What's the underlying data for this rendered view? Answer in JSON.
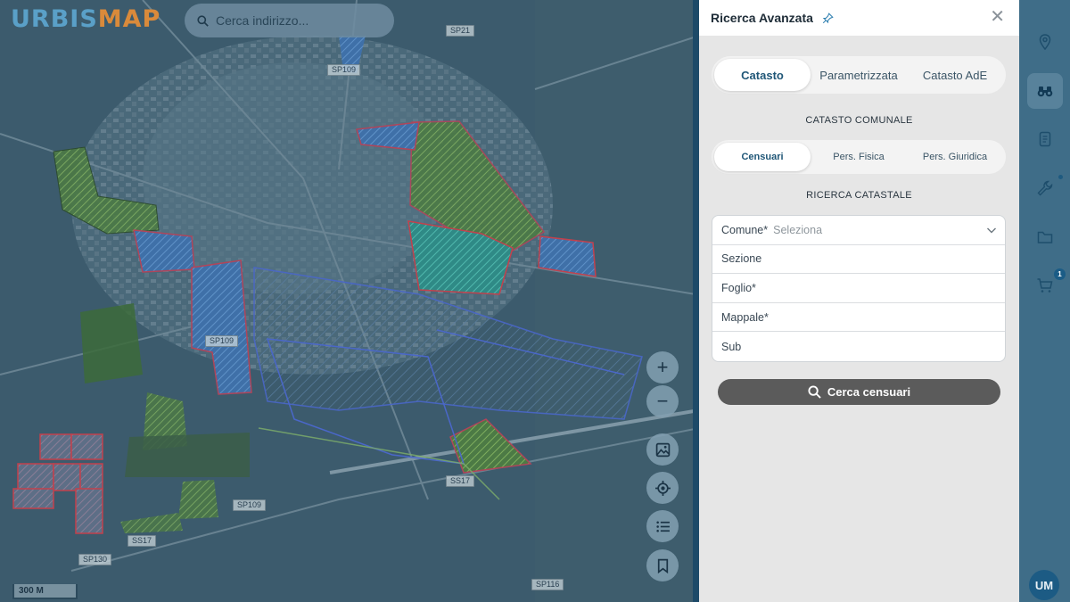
{
  "app": {
    "logo_part1": "URBIS",
    "logo_part2": "MAP"
  },
  "map": {
    "search_placeholder": "Cerca indirizzo...",
    "road_labels": [
      "SP21",
      "SP109",
      "SP109",
      "SP109",
      "SS17",
      "SS17",
      "SP130",
      "SP116"
    ],
    "scale_label": "300 M",
    "controls": {
      "zoom_in": "+",
      "zoom_out": "−",
      "layers_icon": "image-icon",
      "locate_icon": "target-icon",
      "legend_icon": "list-icon",
      "bookmark_icon": "bookmark-icon"
    }
  },
  "panel": {
    "title": "Ricerca Avanzata",
    "pin_icon": "pin-icon",
    "close_icon": "close-icon",
    "tabs": [
      {
        "label": "Catasto",
        "active": true
      },
      {
        "label": "Parametrizzata",
        "active": false
      },
      {
        "label": "Catasto AdE",
        "active": false
      }
    ],
    "section_catasto": "CATASTO COMUNALE",
    "subtabs": [
      {
        "label": "Censuari",
        "active": true
      },
      {
        "label": "Pers. Fisica",
        "active": false
      },
      {
        "label": "Pers. Giuridica",
        "active": false
      }
    ],
    "section_ricerca": "RICERCA CATASTALE",
    "form": {
      "comune_label": "Comune*",
      "comune_value": "Seleziona",
      "sezione_placeholder": "Sezione",
      "foglio_placeholder": "Foglio*",
      "mappale_placeholder": "Mappale*",
      "sub_placeholder": "Sub"
    },
    "search_button": "Cerca censuari"
  },
  "sidebar": {
    "items": [
      {
        "icon": "location-pin-icon"
      },
      {
        "icon": "binoculars-icon",
        "active": true
      },
      {
        "icon": "document-icon"
      },
      {
        "icon": "wrench-icon"
      },
      {
        "icon": "folder-icon"
      },
      {
        "icon": "cart-icon",
        "badge": "1"
      }
    ],
    "avatar": "UM"
  },
  "colors": {
    "map_overlay": "#2d4f66",
    "panel_bg": "#e6e6e6",
    "accent": "#1f5677",
    "button": "#5b5b5b",
    "sidebar": "#3f6d88",
    "parcel_red": "#c2414d",
    "parcel_green": "#4f8a3a",
    "parcel_blue": "#3d6fc2"
  }
}
